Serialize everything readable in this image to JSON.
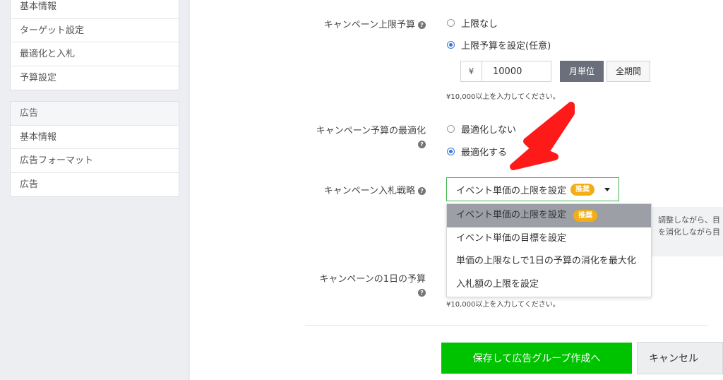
{
  "sidebar": {
    "group1": [
      "基本情報",
      "ターゲット設定",
      "最適化と入札",
      "予算設定"
    ],
    "group2_head": "広告",
    "group2": [
      "基本情報",
      "広告フォーマット",
      "広告"
    ]
  },
  "form": {
    "budget_cap": {
      "label": "キャンペーン上限予算",
      "option_none": "上限なし",
      "option_set": "上限予算を設定(任意)",
      "currency": "¥",
      "value": "10000",
      "period_month": "月単位",
      "period_all": "全期間",
      "hint": "¥10,000以上を入力してください。"
    },
    "budget_opt": {
      "label": "キャンペーン予算の最適化",
      "option_off": "最適化しない",
      "option_on": "最適化する"
    },
    "bid_strategy": {
      "label": "キャンペーン入札戦略",
      "selected": "イベント単価の上限を設定",
      "badge": "推奨",
      "options": [
        {
          "label": "イベント単価の上限を設定",
          "badge": "推奨"
        },
        {
          "label": "イベント単価の目標を設定"
        },
        {
          "label": "単価の上限なしで1日の予算の消化を最大化"
        },
        {
          "label": "入札額の上限を設定"
        }
      ],
      "desc_lines": [
        "調整しながら、目",
        "を消化しながら目"
      ]
    },
    "daily_budget": {
      "label": "キャンペーンの1日の予算",
      "hint": "¥10,000以上を入力してください。"
    }
  },
  "buttons": {
    "save": "保存して広告グループ作成へ",
    "cancel": "キャンセル"
  },
  "colors": {
    "primary_green": "#00c300",
    "radio_blue": "#3478d6",
    "badge_orange": "#f3ad15",
    "annotation_red": "#ff1a1a"
  },
  "icons": {
    "help": "question-circle-icon",
    "dropdown": "caret-down-icon"
  }
}
